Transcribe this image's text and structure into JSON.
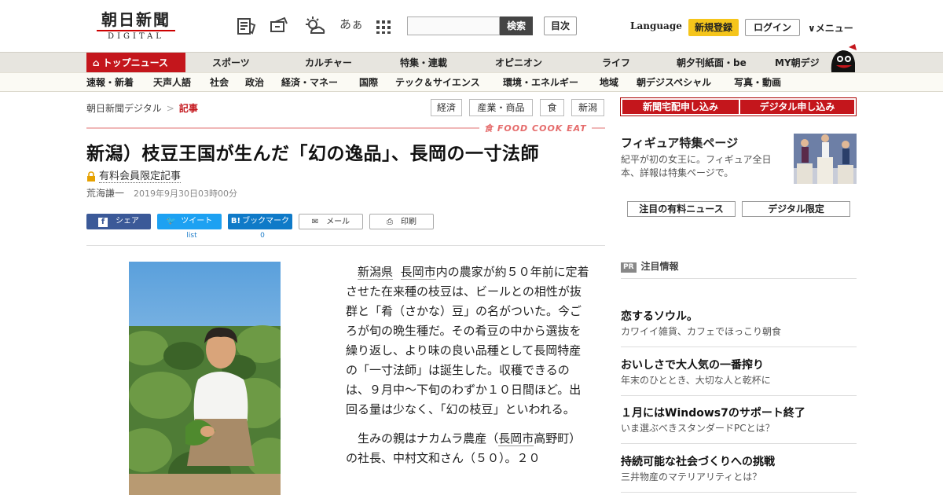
{
  "logo": {
    "jp": "朝日新聞",
    "en": "DIGITAL"
  },
  "header": {
    "icons": [
      "newspaper-icon",
      "coupon-icon",
      "weather-icon",
      "font-size-icon",
      "apps-grid-icon"
    ],
    "font_size_glyph": "あぁ",
    "search_placeholder": "",
    "search_button": "検索",
    "mokuji": "目次",
    "language": "Language",
    "register": "新規登録",
    "login": "ログイン",
    "menu": "メニュー"
  },
  "nav_primary": [
    {
      "label": "トップニュース",
      "active": true
    },
    {
      "label": "スポーツ"
    },
    {
      "label": "カルチャー"
    },
    {
      "label": "特集・連載"
    },
    {
      "label": "オピニオン"
    },
    {
      "label": "ライフ"
    },
    {
      "label": "朝夕刊紙面・be"
    },
    {
      "label": "MY朝デジ"
    }
  ],
  "nav_secondary": [
    "速報・新着",
    "天声人語",
    "社会",
    "政治",
    "経済・マネー",
    "国際",
    "テック＆サイエンス",
    "環境・エネルギー",
    "地域",
    "朝デジスペシャル",
    "写真・動画"
  ],
  "breadcrumb": {
    "home": "朝日新聞デジタル",
    "sep": ">",
    "current": "記事"
  },
  "tags": [
    "経済",
    "産業・商品",
    "食",
    "新潟"
  ],
  "food_label": "FOOD COOK EAT",
  "article": {
    "title": "新潟）枝豆王国が生んだ「幻の逸品」、長岡の一寸法師",
    "member_only": "有料会員限定記事",
    "author": "荒海謙一",
    "date": "2019年9月30日03時00分",
    "p1_link1": "新潟県",
    "p1_link2": "長岡市",
    "p1_text": "内の農家が約５０年前に定着させた在来種の枝豆は、ビールとの相性が抜群と「肴（さかな）豆」の名がついた。今ごろが旬の晩生種だ。その肴豆の中から選抜を繰り返し、より味の良い品種として長岡特産の「一寸法師」は誕生した。収穫できるのは、９月中～下旬のわずか１０日間ほど。出回る量は少なく、「幻の枝豆」といわれる。",
    "p2_a": "生みの親はナカムラ農産（",
    "p2_link": "長岡市",
    "p2_b": "高野町）の社長、中村文和さん（５０）。２０"
  },
  "share": {
    "facebook": "シェア",
    "twitter": "ツイート",
    "hatena": "ブックマーク",
    "mail": "メール",
    "print": "印刷",
    "twitter_count": "list",
    "hatena_count": "0"
  },
  "sidebar": {
    "subscribe_paper": "新聞宅配申し込み",
    "subscribe_digital": "デジタル申し込み",
    "figure_title": "フィギュア特集ページ",
    "figure_desc": "紀平が初の女王に。フィギュア全日本、詳報は特集ページで。",
    "btn_news": "注目の有料ニュース",
    "btn_digital": "デジタル限定",
    "pr_badge": "PR",
    "pr_heading": "注目情報",
    "pr_items": [
      {
        "title": "恋するソウル。",
        "sub": "カワイイ雑貨、カフェでほっこり朝食"
      },
      {
        "title": "おいしさで大人気の一番搾り",
        "sub": "年末のひととき、大切な人と乾杯に"
      },
      {
        "title": "１月にはWindows7のサポート終了",
        "sub": "いま選ぶべきスタンダードPCとは？"
      },
      {
        "title": "持続可能な社会づくりへの挑戦",
        "sub": "三井物産のマテリアリティとは？"
      }
    ]
  }
}
